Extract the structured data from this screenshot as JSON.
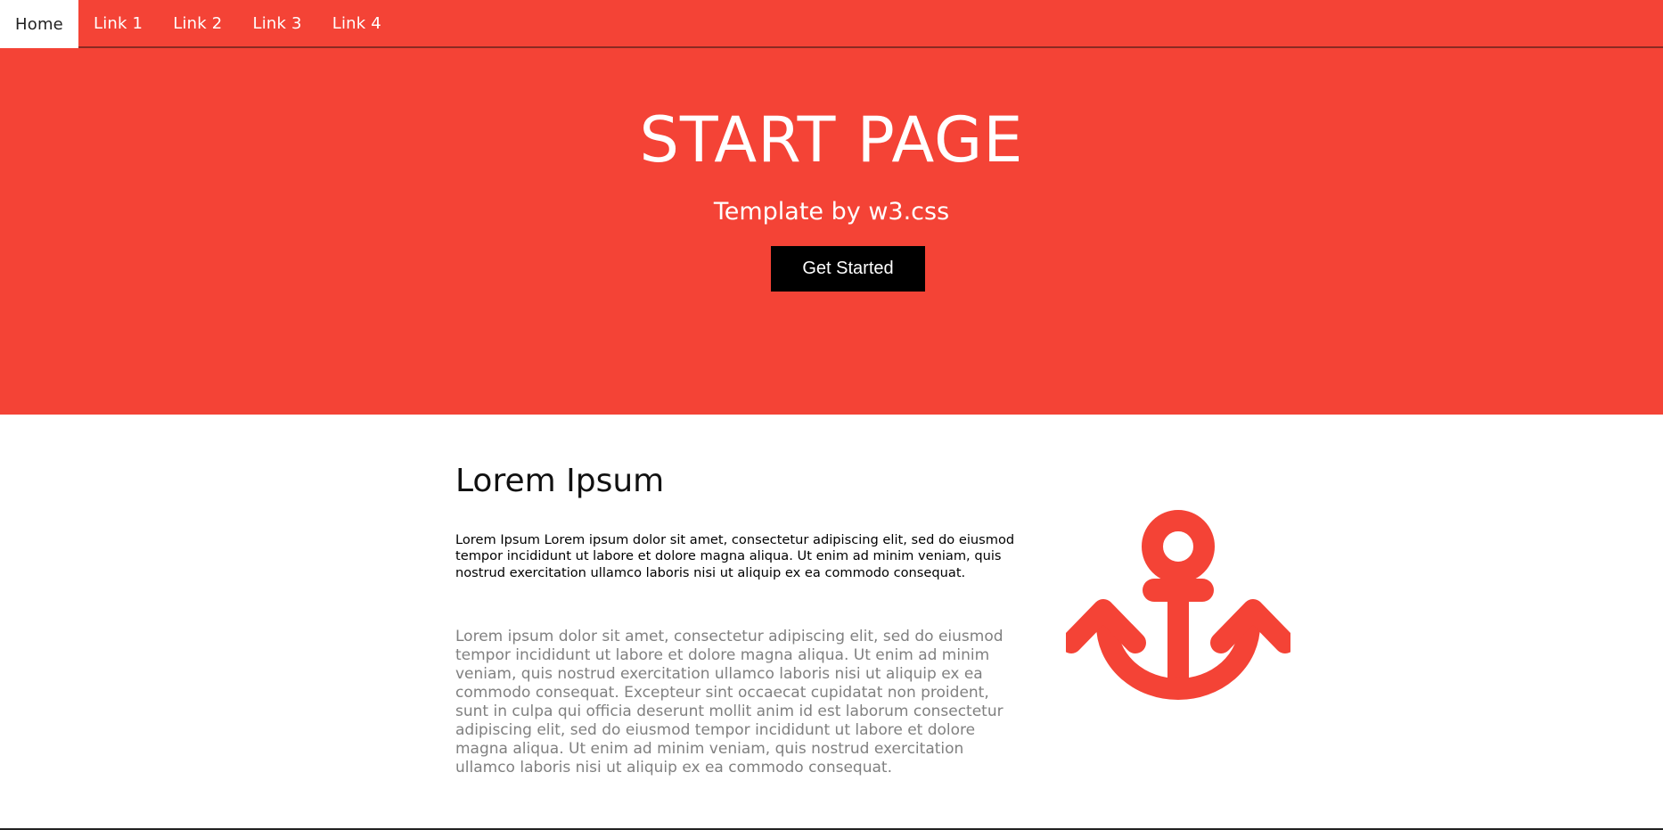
{
  "nav": {
    "items": [
      {
        "label": "Home",
        "active": true
      },
      {
        "label": "Link 1",
        "active": false
      },
      {
        "label": "Link 2",
        "active": false
      },
      {
        "label": "Link 3",
        "active": false
      },
      {
        "label": "Link 4",
        "active": false
      }
    ]
  },
  "hero": {
    "title": "START PAGE",
    "subtitle": "Template by w3.css",
    "button_label": "Get Started"
  },
  "content": {
    "title": "Lorem Ipsum",
    "lead": "Lorem Ipsum Lorem ipsum dolor sit amet, consectetur adipiscing elit, sed do eiusmod tempor incididunt ut labore et dolore magna aliqua. Ut enim ad minim veniam, quis nostrud exercitation ullamco laboris nisi ut aliquip ex ea commodo consequat.",
    "body": "Lorem ipsum dolor sit amet, consectetur adipiscing elit, sed do eiusmod tempor incididunt ut labore et dolore magna aliqua. Ut enim ad minim veniam, quis nostrud exercitation ullamco laboris nisi ut aliquip ex ea commodo consequat. Excepteur sint occaecat cupidatat non proident, sunt in culpa qui officia deserunt mollit anim id est laborum consectetur adipiscing elit, sed do eiusmod tempor incididunt ut labore et dolore magna aliqua. Ut enim ad minim veniam, quis nostrud exercitation ullamco laboris nisi ut aliquip ex ea commodo consequat.",
    "icon": "anchor-icon"
  },
  "colors": {
    "brand": "#f44336",
    "button_bg": "#000000",
    "muted_text": "#808080"
  }
}
